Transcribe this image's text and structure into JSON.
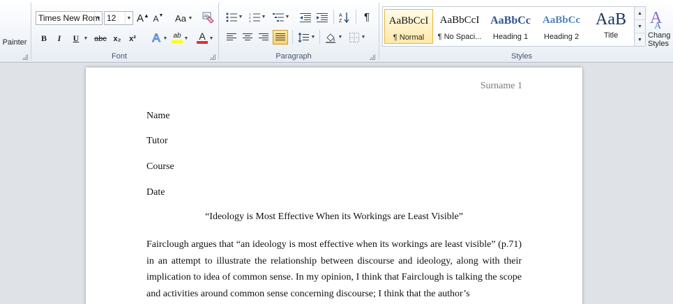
{
  "ribbon": {
    "clipboard": {
      "painter_label": "Painter"
    },
    "font": {
      "group_label": "Font",
      "font_name": "Times New Rom",
      "font_size": "12",
      "grow_label": "A",
      "shrink_label": "A",
      "change_case_label": "Aa",
      "bold_label": "B",
      "italic_label": "I",
      "underline_label": "U",
      "strike_label": "abc",
      "subscript_label": "x₂",
      "superscript_label": "x²",
      "text_effects_label": "A",
      "highlight_label": "ab",
      "font_color_label": "A",
      "highlight_color": "#ffff00",
      "font_color": "#e03030"
    },
    "paragraph": {
      "group_label": "Paragraph",
      "pilcrow": "¶"
    },
    "styles": {
      "group_label": "Styles",
      "items": [
        {
          "sample": "AaBbCcI",
          "name": "¶ Normal",
          "selected": true
        },
        {
          "sample": "AaBbCcI",
          "name": "¶ No Spaci..."
        },
        {
          "sample": "AaBbCс",
          "name": "Heading 1"
        },
        {
          "sample": "AaBbCc",
          "name": "Heading 2"
        },
        {
          "sample": "AaB",
          "name": "Title"
        }
      ],
      "change_styles_line1": "Chang",
      "change_styles_line2": "Styles",
      "heading_color": "#2f5496",
      "accent_color": "#4f81bd"
    }
  },
  "document": {
    "header": "Surname 1",
    "name_line": "Name",
    "tutor_line": "Tutor",
    "course_line": "Course",
    "date_line": "Date",
    "title": "“Ideology is Most Effective When its Workings are Least Visible”",
    "body": "Fairclough argues that “an ideology is most effective when its workings are least visible” (p.71) in an attempt to illustrate the relationship between discourse and ideology, along with their implication to idea of common sense. In my opinion, I think that Fairclough is talking the scope and activities around common sense concerning discourse; I think that the author’s"
  }
}
